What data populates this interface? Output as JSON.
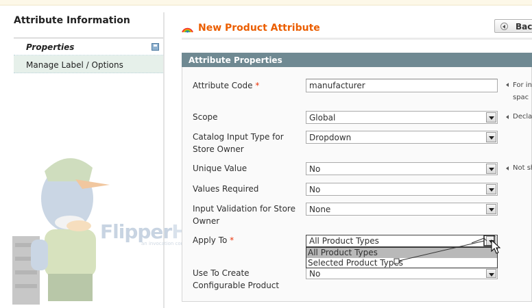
{
  "sidebar": {
    "title": "Attribute Information",
    "items": [
      {
        "label": "Properties",
        "active": true
      },
      {
        "label": "Manage Label / Options",
        "active": false
      }
    ]
  },
  "header": {
    "title": "New Product Attribute",
    "back_label": "Back"
  },
  "watermark": {
    "brand_a": "Flipper",
    "brand_b": "Host",
    "tagline": "an invocation company"
  },
  "form": {
    "section_title": "Attribute Properties",
    "fields": {
      "attribute_code": {
        "label": "Attribute Code",
        "required": "*",
        "value": "manufacturer",
        "note": "For in spac"
      },
      "scope": {
        "label": "Scope",
        "value": "Global",
        "note": "Decla"
      },
      "input_type": {
        "label": "Catalog Input Type for Store Owner",
        "value": "Dropdown"
      },
      "unique_value": {
        "label": "Unique Value",
        "value": "No",
        "note": "Not sh"
      },
      "values_required": {
        "label": "Values Required",
        "value": "No"
      },
      "input_validation": {
        "label": "Input Validation for Store Owner",
        "value": "None"
      },
      "apply_to": {
        "label": "Apply To",
        "required": "*",
        "value": "All Product Types",
        "options": [
          "All Product Types",
          "Selected Product Types"
        ]
      },
      "configurable": {
        "label": "Use To Create Configurable Product",
        "value": "No"
      }
    }
  },
  "colors": {
    "accent": "#eb5e00",
    "section_header": "#6f8992",
    "sidebar_highlight": "#e6f0ea",
    "required": "#eb340a"
  },
  "icons": [
    "rainbow-icon",
    "save-icon",
    "back-arrow-icon",
    "dropdown-arrow-icon",
    "cursor-icon"
  ]
}
